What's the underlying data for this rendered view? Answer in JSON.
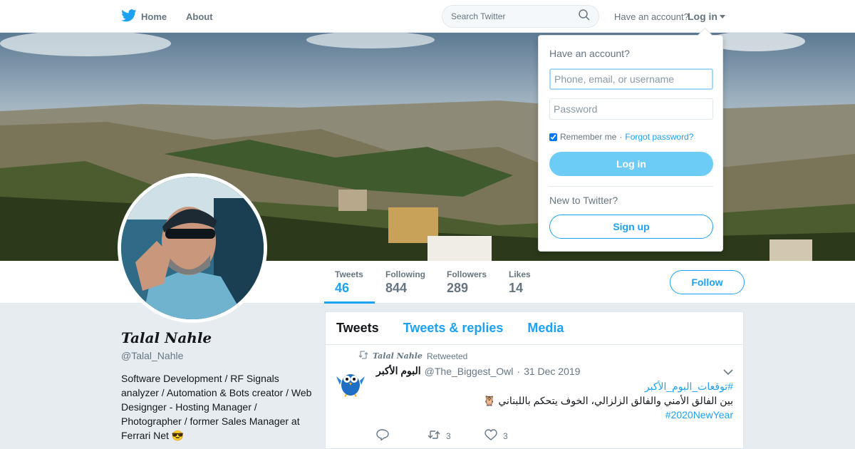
{
  "nav": {
    "home_label": "Home",
    "about_label": "About",
    "search_placeholder": "Search Twitter",
    "have_account": "Have an account?",
    "login_label": "Log in"
  },
  "profile": {
    "name": "Talal Nahle",
    "handle": "@Talal_Nahle",
    "bio": "Software Development / RF Signals analyzer / Automation & Bots creator / Web Designger - Hosting Manager / Photographer / former Sales Manager at Ferrari Net 😎",
    "follow_label": "Follow"
  },
  "stats": [
    {
      "label": "Tweets",
      "value": "46"
    },
    {
      "label": "Following",
      "value": "844"
    },
    {
      "label": "Followers",
      "value": "289"
    },
    {
      "label": "Likes",
      "value": "14"
    }
  ],
  "timeline": {
    "tabs": [
      {
        "label": "Tweets"
      },
      {
        "label": "Tweets & replies"
      },
      {
        "label": "Media"
      }
    ],
    "tweet": {
      "retweeter": "Talal Nahle",
      "retweeted_label": "Retweeted",
      "author_name": "البوم الأكبر",
      "author_handle": "@The_Biggest_Owl",
      "date": "31 Dec 2019",
      "hashtag1": "#توقعات_البوم_الأكبر",
      "body": "بين الفالق الأمني والفالق الزلزالي، الخوف يتحكم باللبناني 🦉",
      "hashtag2": "#2020NewYear",
      "retweets": "3",
      "likes": "3"
    }
  },
  "login_dropdown": {
    "title": "Have an account?",
    "username_placeholder": "Phone, email, or username",
    "password_placeholder": "Password",
    "remember_label": "Remember me",
    "separator": "·",
    "forgot_label": "Forgot password?",
    "login_button": "Log in",
    "new_label": "New to Twitter?",
    "signup_button": "Sign up"
  },
  "colors": {
    "accent": "#1da1f2",
    "login_button": "#6dccf5",
    "background": "#e6ecf0"
  },
  "icons": [
    "twitter-bird-icon",
    "search-icon",
    "caret-down-icon",
    "retweet-icon",
    "reply-icon",
    "like-icon",
    "chevron-down-icon"
  ]
}
